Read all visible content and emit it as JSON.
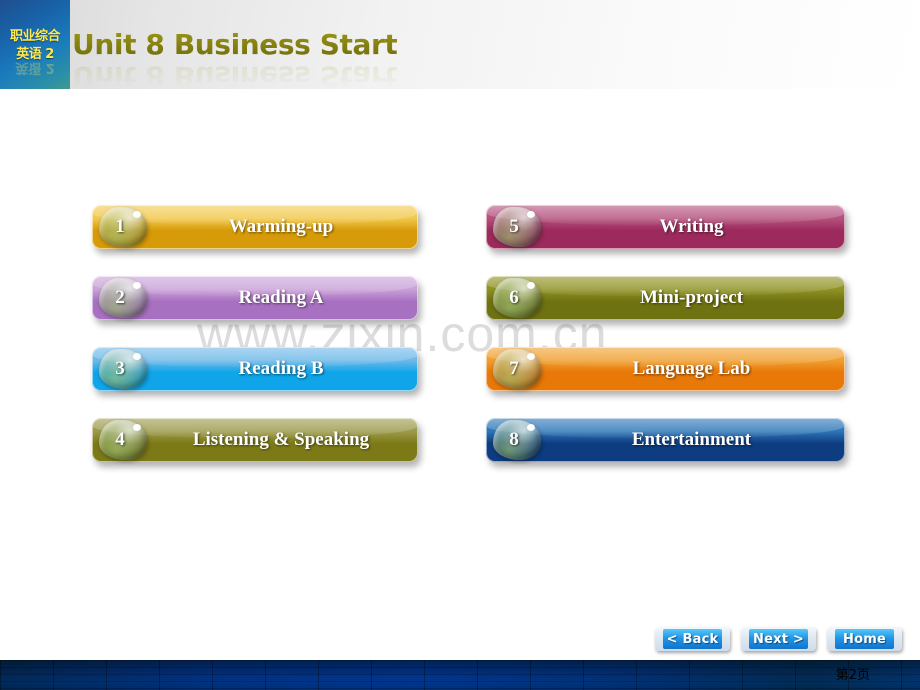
{
  "header": {
    "logo": {
      "line1": "职业综合",
      "line2": "英语 2"
    },
    "title": "Unit 8 Business Start",
    "title_color": "#8a8a1a"
  },
  "watermark": {
    "text": "www.zixin.com.cn"
  },
  "menu": {
    "left_column": [
      {
        "number": "1",
        "label": "Warming-up",
        "color_top": "#f2c94c",
        "color_bottom": "#d79b09"
      },
      {
        "number": "2",
        "label": "Reading A",
        "color_top": "#c9a2d8",
        "color_bottom": "#a870c0"
      },
      {
        "number": "3",
        "label": "Reading B",
        "color_top": "#6fb9e8",
        "color_bottom": "#0fa5e8"
      },
      {
        "number": "4",
        "label": "Listening & Speaking",
        "color_top": "#9c9a4c",
        "color_bottom": "#7c7a16"
      }
    ],
    "right_column": [
      {
        "number": "5",
        "label": "Writing",
        "color_top": "#b5527e",
        "color_bottom": "#9c2a5c"
      },
      {
        "number": "6",
        "label": "Mini-project",
        "color_top": "#8f9224",
        "color_bottom": "#6f7210"
      },
      {
        "number": "7",
        "label": "Language Lab",
        "color_top": "#f0a030",
        "color_bottom": "#e87808"
      },
      {
        "number": "8",
        "label": "Entertainment",
        "color_top": "#2e76b8",
        "color_bottom": "#0d3c80"
      }
    ]
  },
  "navigation": {
    "back_label": "< Back",
    "next_label": "Next >",
    "home_label": "Home"
  },
  "footer": {
    "page_label": "第2页"
  }
}
